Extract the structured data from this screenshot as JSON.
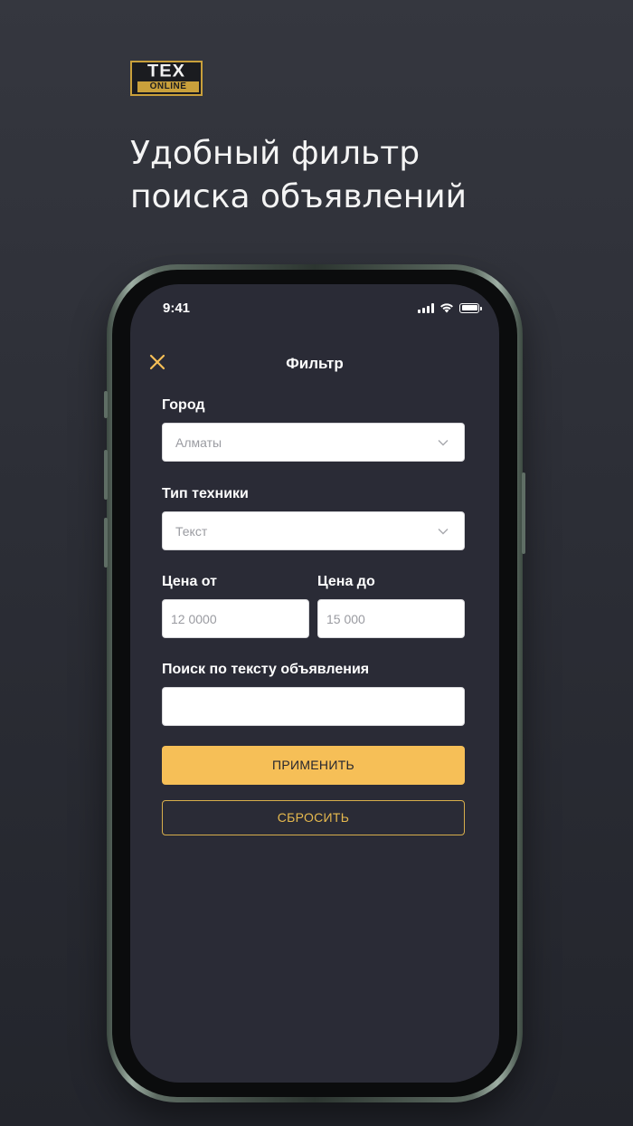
{
  "logo": {
    "top": "TEX",
    "bottom": "ONLINE"
  },
  "headline": {
    "line1": "Удобный фильтр",
    "line2": "поиска объявлений"
  },
  "status_bar": {
    "time": "9:41"
  },
  "nav": {
    "title": "Фильтр",
    "close_icon": "close-x-icon",
    "accent_color": "#f6bf57"
  },
  "form": {
    "city": {
      "label": "Город",
      "value": "Алматы"
    },
    "type": {
      "label": "Тип техники",
      "value": "Текст"
    },
    "price_from": {
      "label": "Цена от",
      "value": "12 0000"
    },
    "price_to": {
      "label": "Цена до",
      "value": "15 000"
    },
    "search_text": {
      "label": "Поиск по тексту объявления",
      "value": ""
    },
    "apply_label": "ПРИМЕНИТЬ",
    "reset_label": "СБРОСИТЬ"
  },
  "colors": {
    "background": "#2c2e36",
    "screen": "#2a2b36",
    "apply_button": "#f6bf57",
    "reset_border": "#d7ae4c"
  }
}
